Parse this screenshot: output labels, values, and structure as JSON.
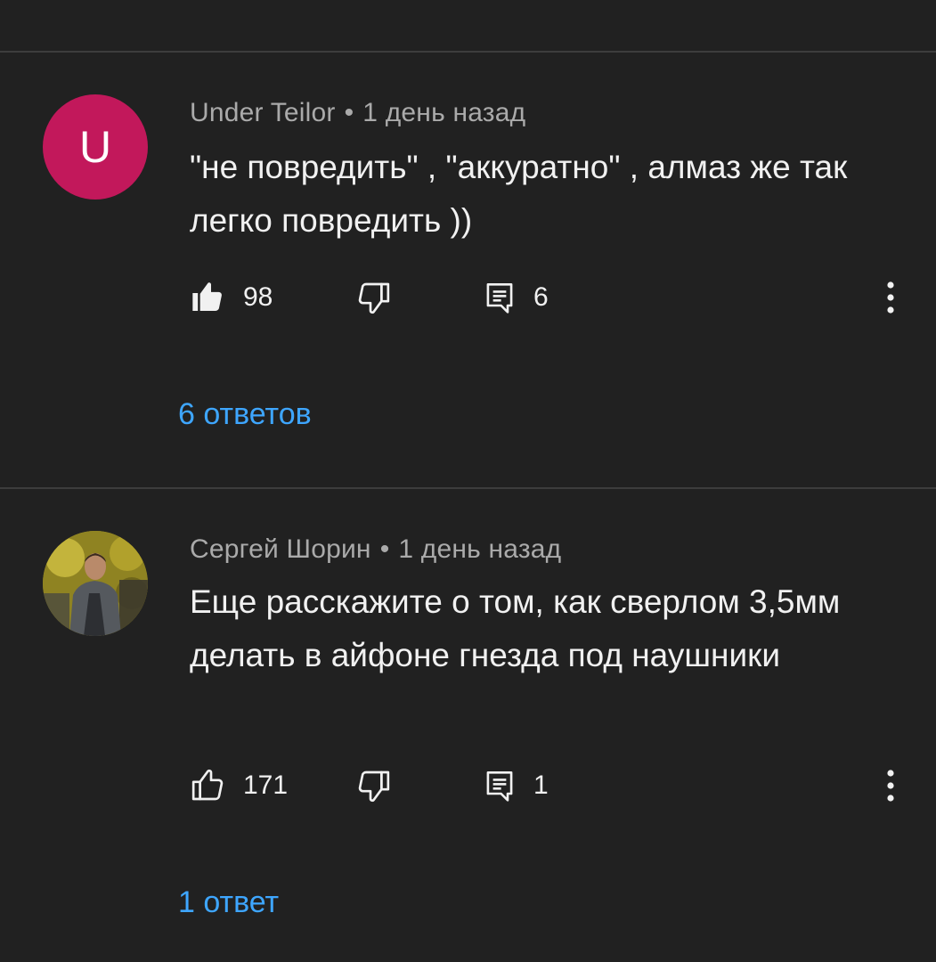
{
  "comments": [
    {
      "avatar_letter": "U",
      "avatar_color": "#c2185b",
      "author": "Under Teilor",
      "separator": "•",
      "time": "1 день назад",
      "text": "\"не повредить\" , \"аккуратно\" , алмаз же так легко повредить ))",
      "likes": "98",
      "liked": true,
      "replies_count": "6",
      "replies_link": "6 ответов"
    },
    {
      "avatar_letter": "",
      "author": "Сергей Шорин",
      "separator": "•",
      "time": "1 день назад",
      "text": "Еще расскажите о том, как сверлом 3,5мм делать в айфоне гнезда под наушники",
      "likes": "171",
      "liked": false,
      "replies_count": "1",
      "replies_link": "1 ответ"
    }
  ],
  "colors": {
    "background": "#212121",
    "divider": "#3d3d3d",
    "meta_text": "#aaaaaa",
    "link": "#3ea6ff"
  }
}
